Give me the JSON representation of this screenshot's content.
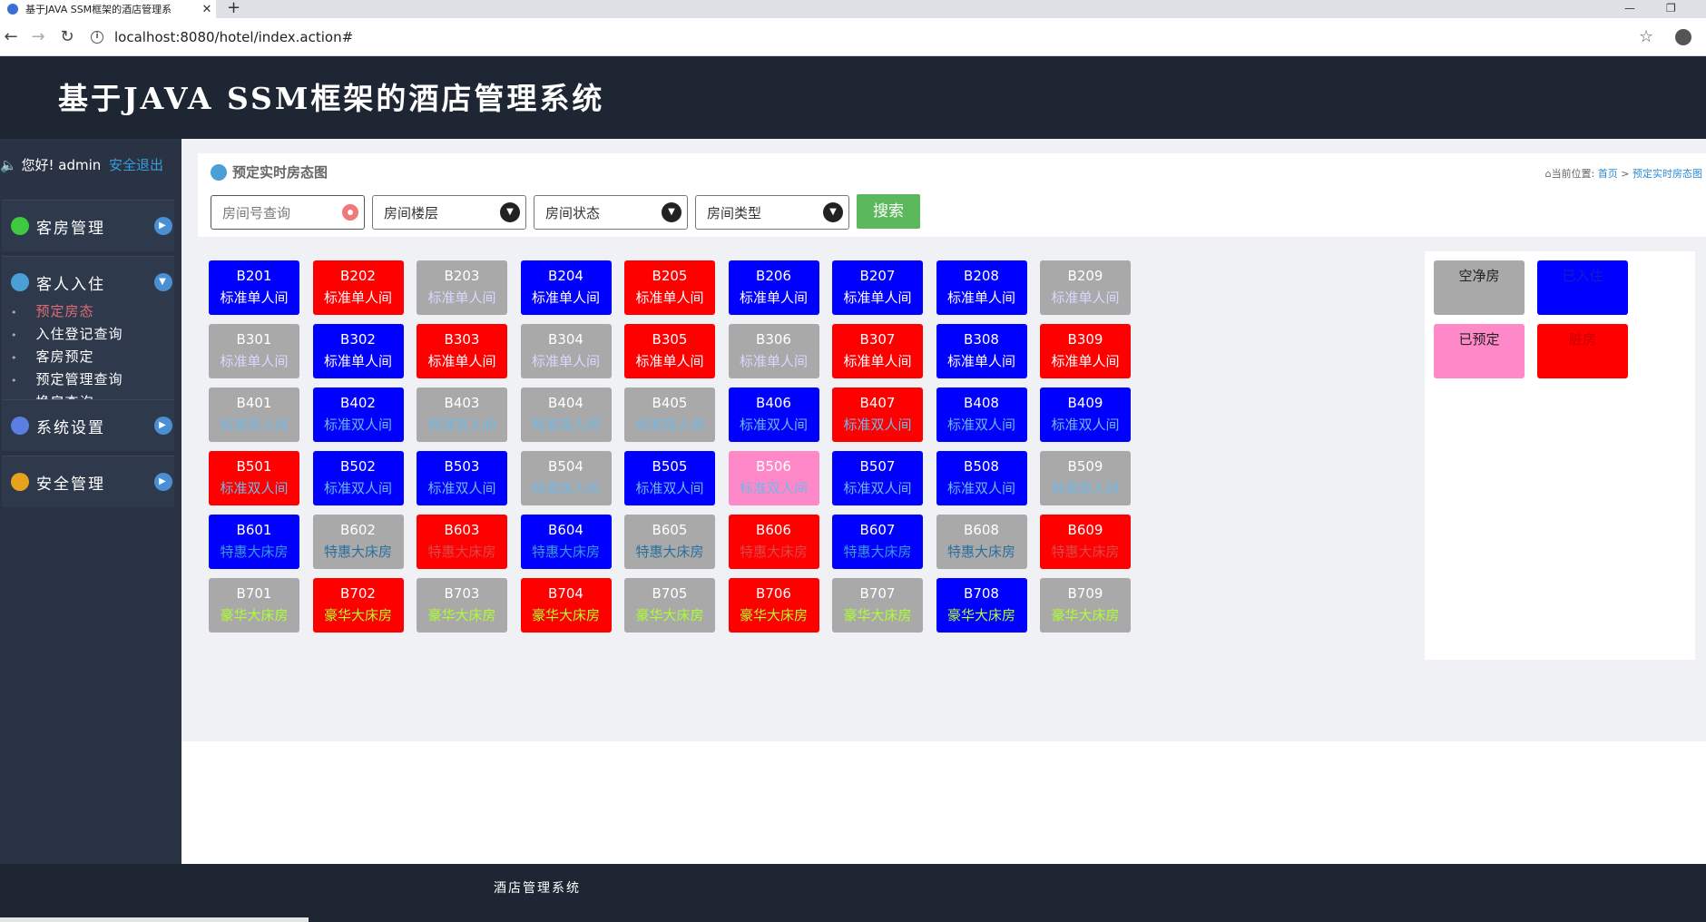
{
  "browser": {
    "tab_title": "基于JAVA SSM框架的酒店管理系",
    "url": "localhost:8080/hotel/index.action#",
    "new_tab_icon": "+",
    "close_icon": "✕"
  },
  "app": {
    "title": "基于JAVA SSM框架的酒店管理系统"
  },
  "sidebar": {
    "greeting": "您好! admin",
    "logout": "安全退出",
    "groups": [
      {
        "label": "客房管理",
        "icon": "bolt-icon",
        "icon_color": "#3ec93e"
      },
      {
        "label": "客人入住",
        "icon": "dashboard-icon",
        "icon_color": "#4a9fd6",
        "items": [
          "预定房态",
          "入住登记查询",
          "客房预定",
          "预定管理查询",
          "换房查询"
        ]
      },
      {
        "label": "系统设置",
        "icon": "settings-icon",
        "icon_color": "#5a7fe0"
      },
      {
        "label": "安全管理",
        "icon": "shield-icon",
        "icon_color": "#e8a31c"
      }
    ]
  },
  "page": {
    "title": "预定实时房态图",
    "breadcrumb_prefix": "当前位置:",
    "breadcrumb_home": "首页",
    "breadcrumb_sep": ">",
    "breadcrumb_current": "预定实时房态图"
  },
  "filters": {
    "room_no_placeholder": "房间号查询",
    "floor": "房间楼层",
    "status": "房间状态",
    "type": "房间类型",
    "search": "搜索"
  },
  "colors": {
    "vacant": "#a9a9a9",
    "occupied": "#0000ff",
    "reserved": "#ff88c8",
    "dirty": "#ff0000"
  },
  "rooms": [
    [
      {
        "no": "B201",
        "type": "标准单人间",
        "status": "occupied",
        "tc": "#ffffff"
      },
      {
        "no": "B202",
        "type": "标准单人间",
        "status": "dirty",
        "tc": "#ffffff"
      },
      {
        "no": "B203",
        "type": "标准单人间",
        "status": "vacant",
        "tc": "#d8d8ff"
      },
      {
        "no": "B204",
        "type": "标准单人间",
        "status": "occupied",
        "tc": "#ffffff"
      },
      {
        "no": "B205",
        "type": "标准单人间",
        "status": "dirty",
        "tc": "#ffffff"
      },
      {
        "no": "B206",
        "type": "标准单人间",
        "status": "occupied",
        "tc": "#ffffff"
      },
      {
        "no": "B207",
        "type": "标准单人间",
        "status": "occupied",
        "tc": "#ffffff"
      },
      {
        "no": "B208",
        "type": "标准单人间",
        "status": "occupied",
        "tc": "#ffffff"
      },
      {
        "no": "B209",
        "type": "标准单人间",
        "status": "vacant",
        "tc": "#d8d8ff"
      }
    ],
    [
      {
        "no": "B301",
        "type": "标准单人间",
        "status": "vacant",
        "tc": "#d8d8ff"
      },
      {
        "no": "B302",
        "type": "标准单人间",
        "status": "occupied",
        "tc": "#ffffff"
      },
      {
        "no": "B303",
        "type": "标准单人间",
        "status": "dirty",
        "tc": "#ffffff"
      },
      {
        "no": "B304",
        "type": "标准单人间",
        "status": "vacant",
        "tc": "#d8d8ff"
      },
      {
        "no": "B305",
        "type": "标准单人间",
        "status": "dirty",
        "tc": "#ffffff"
      },
      {
        "no": "B306",
        "type": "标准单人间",
        "status": "vacant",
        "tc": "#d8d8ff"
      },
      {
        "no": "B307",
        "type": "标准单人间",
        "status": "dirty",
        "tc": "#ffffff"
      },
      {
        "no": "B308",
        "type": "标准单人间",
        "status": "occupied",
        "tc": "#ffffff"
      },
      {
        "no": "B309",
        "type": "标准单人间",
        "status": "dirty",
        "tc": "#ffffff"
      }
    ],
    [
      {
        "no": "B401",
        "type": "标准双人间",
        "status": "vacant",
        "tc": "#6fb8e8"
      },
      {
        "no": "B402",
        "type": "标准双人间",
        "status": "occupied",
        "tc": "#6fb8e8"
      },
      {
        "no": "B403",
        "type": "标准双人间",
        "status": "vacant",
        "tc": "#6fb8e8"
      },
      {
        "no": "B404",
        "type": "标准双人间",
        "status": "vacant",
        "tc": "#6fb8e8"
      },
      {
        "no": "B405",
        "type": "标准双人间",
        "status": "vacant",
        "tc": "#6fb8e8"
      },
      {
        "no": "B406",
        "type": "标准双人间",
        "status": "occupied",
        "tc": "#6fb8e8"
      },
      {
        "no": "B407",
        "type": "标准双人间",
        "status": "dirty",
        "tc": "#6fb8e8"
      },
      {
        "no": "B408",
        "type": "标准双人间",
        "status": "occupied",
        "tc": "#6fb8e8"
      },
      {
        "no": "B409",
        "type": "标准双人间",
        "status": "occupied",
        "tc": "#6fb8e8"
      }
    ],
    [
      {
        "no": "B501",
        "type": "标准双人间",
        "status": "dirty",
        "tc": "#6fb8e8"
      },
      {
        "no": "B502",
        "type": "标准双人间",
        "status": "occupied",
        "tc": "#6fb8e8"
      },
      {
        "no": "B503",
        "type": "标准双人间",
        "status": "occupied",
        "tc": "#6fb8e8"
      },
      {
        "no": "B504",
        "type": "标准双人间",
        "status": "vacant",
        "tc": "#6fb8e8"
      },
      {
        "no": "B505",
        "type": "标准双人间",
        "status": "occupied",
        "tc": "#6fb8e8"
      },
      {
        "no": "B506",
        "type": "标准双人间",
        "status": "reserved",
        "tc": "#6fb8e8"
      },
      {
        "no": "B507",
        "type": "标准双人间",
        "status": "occupied",
        "tc": "#6fb8e8"
      },
      {
        "no": "B508",
        "type": "标准双人间",
        "status": "occupied",
        "tc": "#6fb8e8"
      },
      {
        "no": "B509",
        "type": "标准双人间",
        "status": "vacant",
        "tc": "#6fb8e8"
      }
    ],
    [
      {
        "no": "B601",
        "type": "特惠大床房",
        "status": "occupied",
        "tc": "#3b9ad9"
      },
      {
        "no": "B602",
        "type": "特惠大床房",
        "status": "vacant",
        "tc": "#2a6f9e"
      },
      {
        "no": "B603",
        "type": "特惠大床房",
        "status": "dirty",
        "tc": "#d84a4a"
      },
      {
        "no": "B604",
        "type": "特惠大床房",
        "status": "occupied",
        "tc": "#3b9ad9"
      },
      {
        "no": "B605",
        "type": "特惠大床房",
        "status": "vacant",
        "tc": "#2a6f9e"
      },
      {
        "no": "B606",
        "type": "特惠大床房",
        "status": "dirty",
        "tc": "#d84a4a"
      },
      {
        "no": "B607",
        "type": "特惠大床房",
        "status": "occupied",
        "tc": "#3b9ad9"
      },
      {
        "no": "B608",
        "type": "特惠大床房",
        "status": "vacant",
        "tc": "#2a6f9e"
      },
      {
        "no": "B609",
        "type": "特惠大床房",
        "status": "dirty",
        "tc": "#d84a4a"
      }
    ],
    [
      {
        "no": "B701",
        "type": "豪华大床房",
        "status": "vacant",
        "tc": "#adff2f"
      },
      {
        "no": "B702",
        "type": "豪华大床房",
        "status": "dirty",
        "tc": "#adff2f"
      },
      {
        "no": "B703",
        "type": "豪华大床房",
        "status": "vacant",
        "tc": "#adff2f"
      },
      {
        "no": "B704",
        "type": "豪华大床房",
        "status": "dirty",
        "tc": "#adff2f"
      },
      {
        "no": "B705",
        "type": "豪华大床房",
        "status": "vacant",
        "tc": "#adff2f"
      },
      {
        "no": "B706",
        "type": "豪华大床房",
        "status": "dirty",
        "tc": "#adff2f"
      },
      {
        "no": "B707",
        "type": "豪华大床房",
        "status": "vacant",
        "tc": "#adff2f"
      },
      {
        "no": "B708",
        "type": "豪华大床房",
        "status": "occupied",
        "tc": "#adff2f"
      },
      {
        "no": "B709",
        "type": "豪华大床房",
        "status": "vacant",
        "tc": "#adff2f"
      }
    ]
  ],
  "legend": [
    {
      "label": "空净房",
      "status": "vacant",
      "tc": "#222222"
    },
    {
      "label": "已入住",
      "status": "occupied",
      "tc": "#1a1ac8"
    },
    {
      "label": "已预定",
      "status": "reserved",
      "tc": "#222222"
    },
    {
      "label": "脏房",
      "status": "dirty",
      "tc": "#c80000"
    }
  ],
  "footer": {
    "text": "酒店管理系统"
  }
}
